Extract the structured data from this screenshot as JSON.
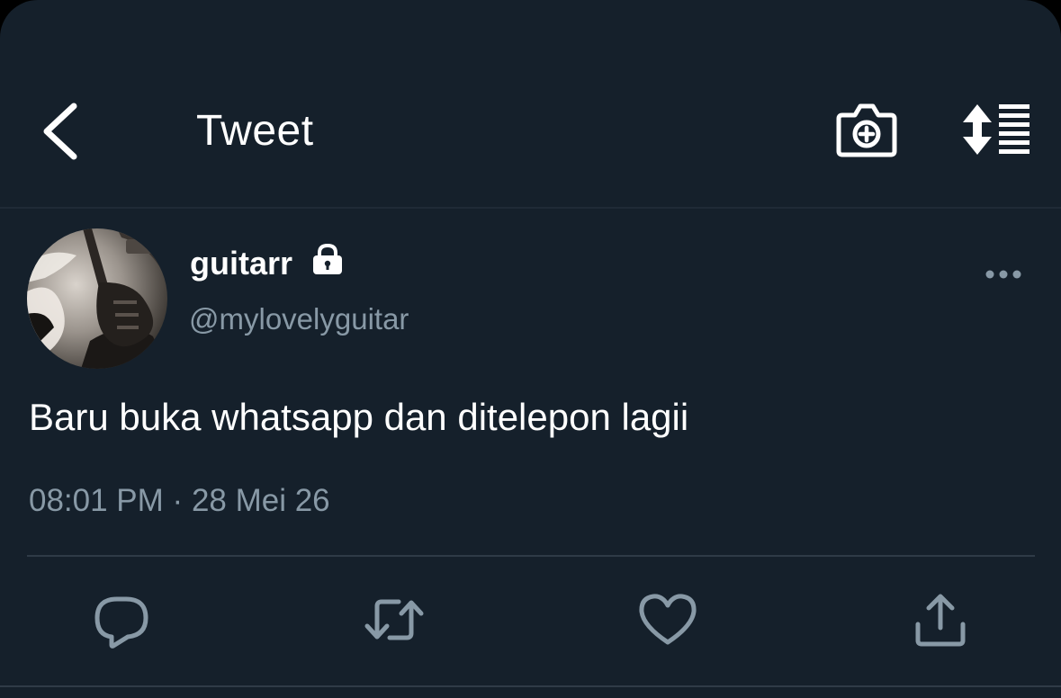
{
  "header": {
    "title": "Tweet",
    "icons": {
      "back": "chevron-left-icon",
      "camera": "camera-plus-icon",
      "sort": "sort-list-icon"
    }
  },
  "tweet": {
    "display_name": "guitarr",
    "handle": "@mylovelyguitar",
    "protected_icon": "lock-icon",
    "text": "Baru buka whatsapp dan ditelepon lagii",
    "time": "08:01 PM",
    "separator": "·",
    "date": "28 Mei 26"
  },
  "actions": [
    "reply-icon",
    "retweet-icon",
    "like-icon",
    "share-icon"
  ],
  "colors": {
    "background": "#15202b",
    "primary_text": "#ffffff",
    "secondary_text": "#8899a6",
    "divider": "#2f3b47"
  }
}
